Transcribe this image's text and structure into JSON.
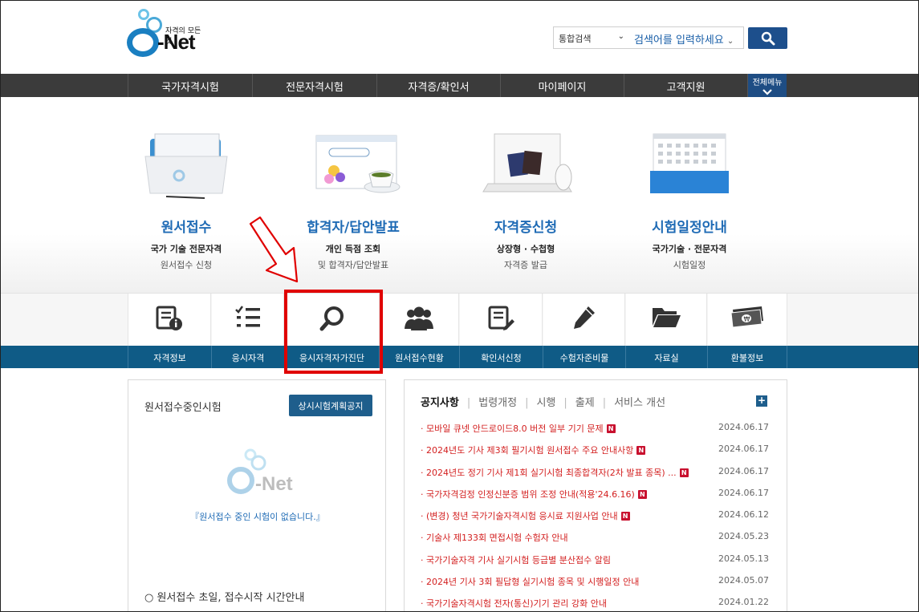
{
  "header": {
    "logo_text": "Net",
    "logo_tagline": "자격의 모든것",
    "search_scope": "통합검색",
    "search_placeholder": "검색어를 입력하세요"
  },
  "gnb": {
    "items": [
      "국가자격시험",
      "전문자격시험",
      "자격증/확인서",
      "마이페이지",
      "고객지원"
    ],
    "all_menu": "전체메뉴"
  },
  "hero_cards": [
    {
      "title": "원서접수",
      "sub1": "국가 기술 전문자격",
      "sub2": "원서접수 신청"
    },
    {
      "title": "합격자/답안발표",
      "sub1": "개인 득점 조회",
      "sub2": "및 합격자/답안발표"
    },
    {
      "title": "자격증신청",
      "sub1": "상장형 · 수첩형",
      "sub2": "자격증 발급"
    },
    {
      "title": "시험일정안내",
      "sub1": "국가기술 · 전문자격",
      "sub2": "시험일정"
    }
  ],
  "quick_menu": [
    "자격정보",
    "응시자격",
    "응시자격자가진단",
    "원서접수현황",
    "확인서신청",
    "수험자준비물",
    "자료실",
    "환불정보"
  ],
  "exam_panel": {
    "title": "원서접수중인시험",
    "button": "상시시험계획공지",
    "empty_message": "『원서접수 중인 시험이 없습니다.』",
    "guide": "○ 원서접수 초일, 접수시작 시간안내"
  },
  "notice_panel": {
    "tabs": [
      "공지사항",
      "법령개정",
      "시행",
      "출제",
      "서비스 개선"
    ],
    "more": "+",
    "new_badge": "N",
    "items": [
      {
        "title": "· 모바일 큐넷 안드로이드8.0 버전 일부 기기 문제",
        "date": "2024.06.17",
        "new": true
      },
      {
        "title": "· 2024년도 기사 제3회 필기시험 원서접수 주요 안내사항",
        "date": "2024.06.17",
        "new": true
      },
      {
        "title": "· 2024년도 정기 기사 제1회 실기시험 최종합격자(2차 발표 종목) ...",
        "date": "2024.06.17",
        "new": true
      },
      {
        "title": "· 국가자격검정 인정신분증 범위 조정 안내(적용'24.6.16)",
        "date": "2024.06.17",
        "new": true
      },
      {
        "title": "· (변경) 청년 국가기술자격시험 응시료 지원사업 안내",
        "date": "2024.06.12",
        "new": true
      },
      {
        "title": "· 기술사 제133회 면접시험 수험자 안내",
        "date": "2024.05.23",
        "new": false
      },
      {
        "title": "· 국가기술자격 기사 실기시험 등급별 분산접수 알림",
        "date": "2024.05.13",
        "new": false
      },
      {
        "title": "· 2024년 기사 3회 필답형 실기시험 종목 및 시행일정 안내",
        "date": "2024.05.07",
        "new": false
      },
      {
        "title": "· 국가기술자격시험 전자(통신)기기 관리 강화 안내",
        "date": "2024.01.22",
        "new": false
      }
    ]
  },
  "colors": {
    "accent": "#1f6bb5",
    "gnb_bg": "#3b3b3b",
    "quickbar_bg": "#0f5b86",
    "notice_red": "#d31f1f",
    "highlight": "#e00000"
  }
}
